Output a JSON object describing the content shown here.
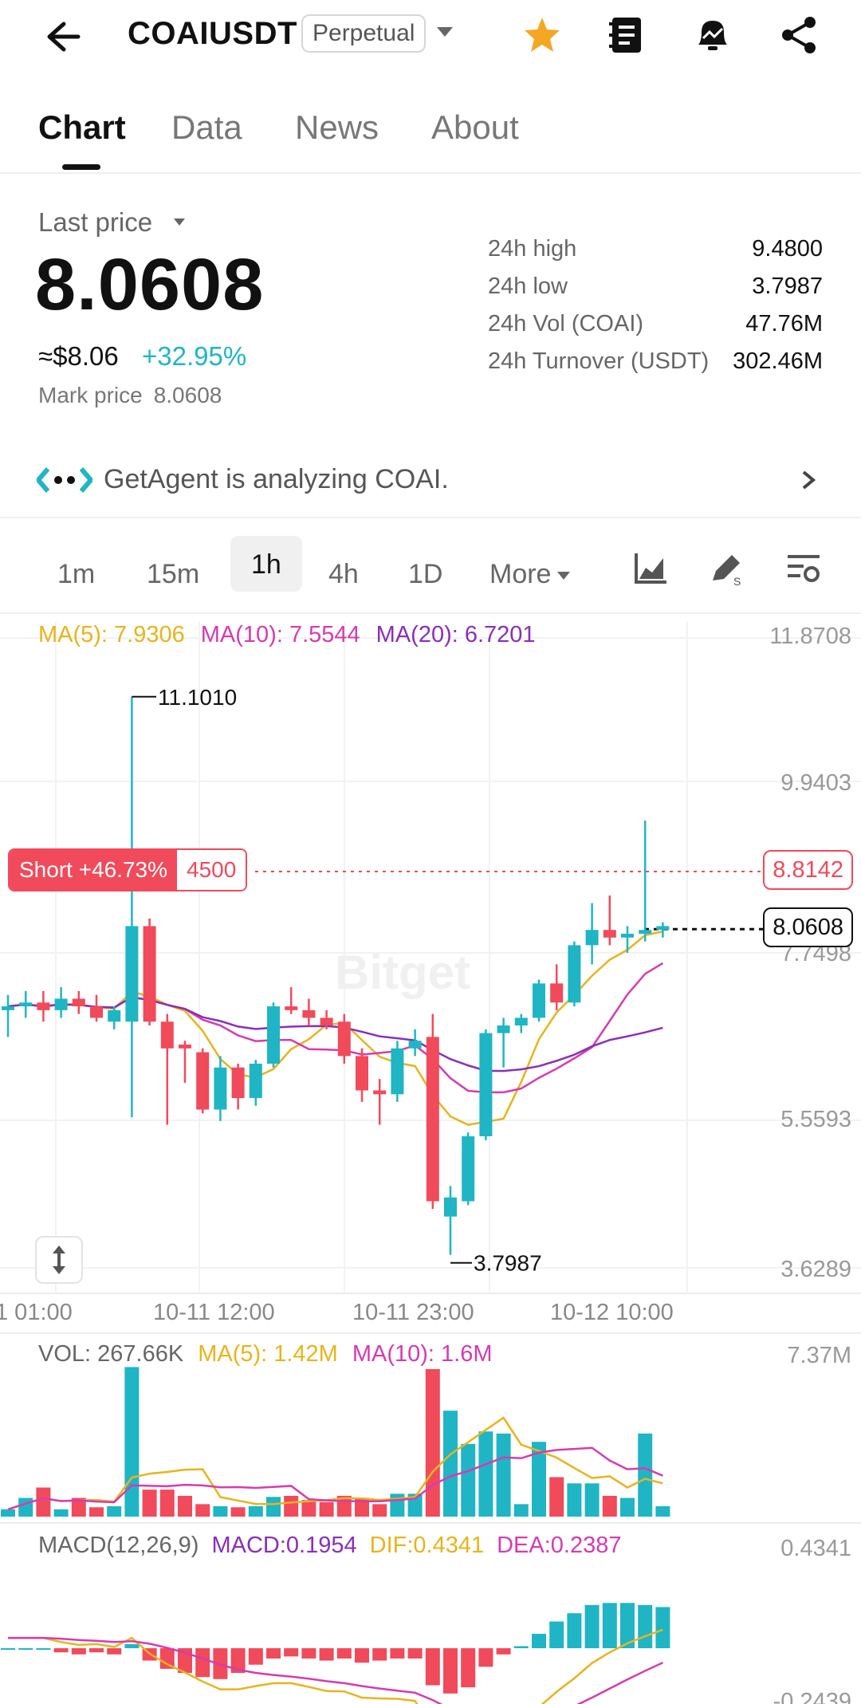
{
  "header": {
    "symbol": "COAIUSDT",
    "contract_type": "Perpetual"
  },
  "tabs": [
    "Chart",
    "Data",
    "News",
    "About"
  ],
  "price": {
    "last_price_label": "Last price",
    "last_price": "8.0608",
    "usd_value": "≈$8.06",
    "change_pct": "+32.95%",
    "mark_label": "Mark price",
    "mark_value": "8.0608"
  },
  "stats": [
    {
      "label": "24h high",
      "value": "9.4800"
    },
    {
      "label": "24h low",
      "value": "3.7987"
    },
    {
      "label": "24h Vol (COAI)",
      "value": "47.76M"
    },
    {
      "label": "24h Turnover (USDT)",
      "value": "302.46M"
    }
  ],
  "agent": {
    "text": "GetAgent is analyzing COAI."
  },
  "intervals": [
    "1m",
    "15m",
    "1h",
    "4h",
    "1D",
    "More"
  ],
  "active_interval": "1h",
  "ma_legend": {
    "ma5": "MA(5): 7.9306",
    "ma10": "MA(10): 7.5544",
    "ma20": "MA(20): 6.7201"
  },
  "price_axis": [
    "11.8708",
    "9.9403",
    "7.7498",
    "5.5593",
    "3.6289"
  ],
  "annotations": {
    "high": "11.1010",
    "low": "3.7987",
    "short_label": "Short +46.73%",
    "short_qty": "4500",
    "short_price": "8.8142",
    "current_price": "8.0608"
  },
  "watermark": "Bitget",
  "time_axis": [
    "1 01:00",
    "10-11 12:00",
    "10-11 23:00",
    "10-12 10:00"
  ],
  "vol_legend": {
    "vol": "VOL: 267.66K",
    "ma5": "MA(5): 1.42M",
    "ma10": "MA(10): 1.6M",
    "axis_max": "7.37M"
  },
  "macd_legend": {
    "name": "MACD(12,26,9)",
    "macd": "MACD:0.1954",
    "dif": "DIF:0.4341",
    "dea": "DEA:0.2387",
    "axis_max": "0.4341",
    "axis_min": "-0.2439"
  },
  "colors": {
    "up": "#1fb5c4",
    "down": "#f04a5b",
    "ma5": "#e8b41c",
    "ma10": "#d63bb0",
    "ma20": "#8a2fb8",
    "accent": "#f5a623"
  },
  "chart_data": {
    "type": "candlestick",
    "candles": [
      {
        "o": 7.0,
        "h": 7.2,
        "l": 6.65,
        "c": 7.05
      },
      {
        "o": 7.05,
        "h": 7.25,
        "l": 6.9,
        "c": 7.1
      },
      {
        "o": 7.1,
        "h": 7.25,
        "l": 6.85,
        "c": 7.0
      },
      {
        "o": 7.0,
        "h": 7.3,
        "l": 6.9,
        "c": 7.15
      },
      {
        "o": 7.15,
        "h": 7.25,
        "l": 6.95,
        "c": 7.05
      },
      {
        "o": 7.05,
        "h": 7.2,
        "l": 6.85,
        "c": 6.9
      },
      {
        "o": 6.85,
        "h": 7.05,
        "l": 6.75,
        "c": 7.0
      },
      {
        "o": 6.85,
        "h": 11.1,
        "l": 5.6,
        "c": 8.1
      },
      {
        "o": 8.1,
        "h": 8.2,
        "l": 6.8,
        "c": 6.85
      },
      {
        "o": 6.85,
        "h": 6.95,
        "l": 5.5,
        "c": 6.5
      },
      {
        "o": 6.55,
        "h": 6.6,
        "l": 6.05,
        "c": 6.5
      },
      {
        "o": 6.45,
        "h": 6.5,
        "l": 5.65,
        "c": 5.7
      },
      {
        "o": 5.7,
        "h": 6.4,
        "l": 5.55,
        "c": 6.25
      },
      {
        "o": 6.25,
        "h": 6.3,
        "l": 5.7,
        "c": 5.85
      },
      {
        "o": 5.85,
        "h": 6.35,
        "l": 5.75,
        "c": 6.3
      },
      {
        "o": 6.3,
        "h": 7.1,
        "l": 6.25,
        "c": 7.05
      },
      {
        "o": 7.05,
        "h": 7.3,
        "l": 6.95,
        "c": 7.0
      },
      {
        "o": 7.0,
        "h": 7.15,
        "l": 6.8,
        "c": 6.9
      },
      {
        "o": 6.9,
        "h": 7.0,
        "l": 6.75,
        "c": 6.8
      },
      {
        "o": 6.85,
        "h": 6.95,
        "l": 6.3,
        "c": 6.4
      },
      {
        "o": 6.4,
        "h": 6.5,
        "l": 5.8,
        "c": 5.95
      },
      {
        "o": 5.95,
        "h": 6.1,
        "l": 5.5,
        "c": 5.9
      },
      {
        "o": 5.9,
        "h": 6.6,
        "l": 5.8,
        "c": 6.5
      },
      {
        "o": 6.5,
        "h": 6.75,
        "l": 6.4,
        "c": 6.6
      },
      {
        "o": 6.65,
        "h": 6.95,
        "l": 4.4,
        "c": 4.5
      },
      {
        "o": 4.3,
        "h": 4.7,
        "l": 3.8,
        "c": 4.55
      },
      {
        "o": 4.5,
        "h": 5.4,
        "l": 4.45,
        "c": 5.35
      },
      {
        "o": 5.35,
        "h": 6.75,
        "l": 5.3,
        "c": 6.7
      },
      {
        "o": 6.7,
        "h": 6.9,
        "l": 6.25,
        "c": 6.8
      },
      {
        "o": 6.8,
        "h": 6.95,
        "l": 6.7,
        "c": 6.9
      },
      {
        "o": 6.9,
        "h": 7.4,
        "l": 6.85,
        "c": 7.35
      },
      {
        "o": 7.35,
        "h": 7.6,
        "l": 7.0,
        "c": 7.1
      },
      {
        "o": 7.1,
        "h": 7.9,
        "l": 7.05,
        "c": 7.85
      },
      {
        "o": 7.85,
        "h": 8.4,
        "l": 7.6,
        "c": 8.05
      },
      {
        "o": 8.05,
        "h": 8.5,
        "l": 7.85,
        "c": 7.95
      },
      {
        "o": 7.95,
        "h": 8.1,
        "l": 7.75,
        "c": 8.0
      },
      {
        "o": 8.0,
        "h": 9.48,
        "l": 7.9,
        "c": 8.05
      },
      {
        "o": 8.05,
        "h": 8.15,
        "l": 7.95,
        "c": 8.1
      }
    ],
    "price_range": [
      3.6289,
      11.8708
    ],
    "volume": [
      0.35,
      0.9,
      1.4,
      0.35,
      0.9,
      0.45,
      0.5,
      7.2,
      1.3,
      1.3,
      1.0,
      0.6,
      0.5,
      0.45,
      0.5,
      0.95,
      1.0,
      0.8,
      0.7,
      1.0,
      0.9,
      0.6,
      1.1,
      1.1,
      7.1,
      5.1,
      3.5,
      4.1,
      4.0,
      0.6,
      3.6,
      1.9,
      1.6,
      1.6,
      1.0,
      0.9,
      4.0,
      0.5
    ],
    "volume_max": 7.37,
    "macd_hist": [
      0.0,
      0.0,
      0.0,
      -0.02,
      -0.03,
      -0.02,
      -0.03,
      0.02,
      -0.06,
      -0.1,
      -0.12,
      -0.14,
      -0.15,
      -0.12,
      -0.08,
      -0.05,
      -0.04,
      -0.05,
      -0.06,
      -0.05,
      -0.07,
      -0.06,
      -0.05,
      -0.05,
      -0.18,
      -0.22,
      -0.19,
      -0.09,
      -0.03,
      0.01,
      0.07,
      0.13,
      0.17,
      0.21,
      0.22,
      0.22,
      0.21,
      0.2
    ],
    "macd_range": [
      -0.2439,
      0.4341
    ]
  }
}
